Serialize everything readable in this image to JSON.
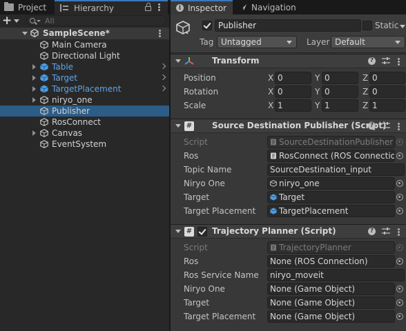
{
  "left_tabs": {
    "project": "Project",
    "hierarchy": "Hierarchy"
  },
  "search": {
    "placeholder": "All"
  },
  "scene": {
    "name": "SampleScene*"
  },
  "hierarchy_items": [
    {
      "label": "Main Camera",
      "prefab": false,
      "expandable": false
    },
    {
      "label": "Directional Light",
      "prefab": false,
      "expandable": false
    },
    {
      "label": "Table",
      "prefab": true,
      "expandable": true
    },
    {
      "label": "Target",
      "prefab": true,
      "expandable": true
    },
    {
      "label": "TargetPlacement",
      "prefab": true,
      "expandable": true
    },
    {
      "label": "niryo_one",
      "prefab": false,
      "expandable": true
    },
    {
      "label": "Publisher",
      "prefab": false,
      "expandable": false,
      "selected": true
    },
    {
      "label": "RosConnect",
      "prefab": false,
      "expandable": false
    },
    {
      "label": "Canvas",
      "prefab": false,
      "expandable": true
    },
    {
      "label": "EventSystem",
      "prefab": false,
      "expandable": false
    }
  ],
  "right_tabs": {
    "inspector": "Inspector",
    "navigation": "Navigation"
  },
  "object": {
    "active": true,
    "name": "Publisher",
    "static_label": "Static",
    "static": false,
    "tag_label": "Tag",
    "tag_value": "Untagged",
    "layer_label": "Layer",
    "layer_value": "Default"
  },
  "transform": {
    "title": "Transform",
    "rows": [
      {
        "label": "Position",
        "x": "0",
        "y": "0",
        "z": "0"
      },
      {
        "label": "Rotation",
        "x": "0",
        "y": "0",
        "z": "0"
      },
      {
        "label": "Scale",
        "x": "1",
        "y": "1",
        "z": "1"
      }
    ],
    "axes": {
      "x": "X",
      "y": "Y",
      "z": "Z"
    }
  },
  "publisher_script": {
    "title": "Source Destination Publisher (Script)",
    "props": [
      {
        "label": "Script",
        "value": "SourceDestinationPublisher",
        "disabled": true,
        "icon": "script",
        "picker": true
      },
      {
        "label": "Ros",
        "value": "RosConnect (ROS Connectio",
        "icon": "script",
        "picker": true
      },
      {
        "label": "Topic Name",
        "value": "SourceDestination_input",
        "picker": false
      },
      {
        "label": "Niryo One",
        "value": "niryo_one",
        "icon": "gameobject",
        "picker": true
      },
      {
        "label": "Target",
        "value": "Target",
        "icon": "prefab",
        "picker": true
      },
      {
        "label": "Target Placement",
        "value": "TargetPlacement",
        "icon": "prefab",
        "picker": true
      }
    ]
  },
  "trajectory_script": {
    "title": "Trajectory Planner (Script)",
    "enabled": true,
    "props": [
      {
        "label": "Script",
        "value": "TrajectoryPlanner",
        "disabled": true,
        "icon": "script",
        "picker": true
      },
      {
        "label": "Ros",
        "value": "None (ROS Connection)",
        "picker": true
      },
      {
        "label": "Ros Service Name",
        "value": "niryo_moveit",
        "picker": false
      },
      {
        "label": "Niryo One",
        "value": "None (Game Object)",
        "picker": true
      },
      {
        "label": "Target",
        "value": "None (Game Object)",
        "picker": true
      },
      {
        "label": "Target Placement",
        "value": "None (Game Object)",
        "picker": true
      }
    ]
  },
  "colors": {
    "selection": "#2c5d87",
    "prefab_text": "#5fa3e8",
    "tab_accent": "#3a79bb",
    "prefab_cube": "#4e9de4"
  }
}
